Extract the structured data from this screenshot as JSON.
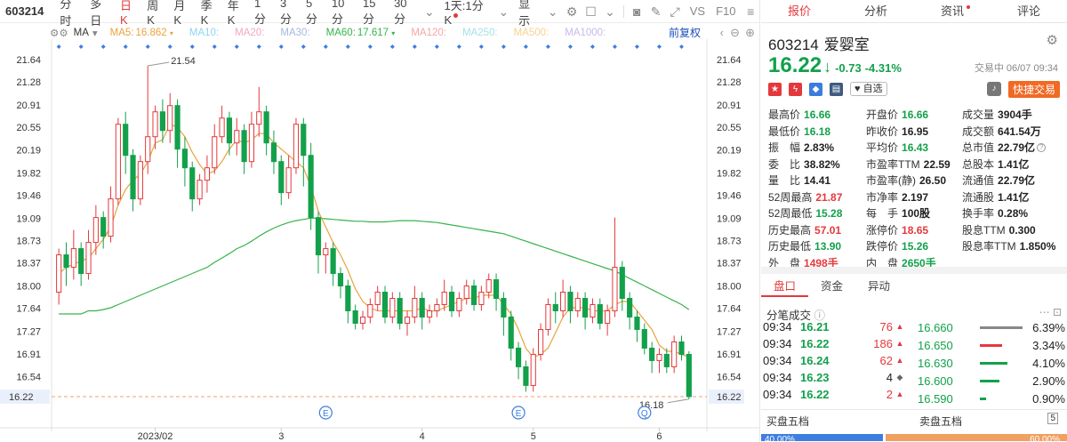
{
  "toolbar": {
    "code": "603214",
    "periods": [
      "分时",
      "多日",
      "日K",
      "周K",
      "月K",
      "季K",
      "年K",
      "1分",
      "3分",
      "5分",
      "10分",
      "15分",
      "30分"
    ],
    "active_period": "日K",
    "frame": "1天:1分K",
    "display": "显示",
    "vs": "VS",
    "f10": "F10"
  },
  "ma_bar": {
    "indicator": "MA",
    "items": [
      {
        "label": "MA5:",
        "value": "16.862",
        "color": "#e8a33d"
      },
      {
        "label": "MA10:",
        "value": "",
        "color": "#8fd3f4"
      },
      {
        "label": "MA20:",
        "value": "",
        "color": "#f4a6c8"
      },
      {
        "label": "MA30:",
        "value": "",
        "color": "#a6b8e0"
      },
      {
        "label": "MA60:",
        "value": "17.617",
        "color": "#36b34a"
      },
      {
        "label": "MA120:",
        "value": "",
        "color": "#f4a6a6"
      },
      {
        "label": "MA250:",
        "value": "",
        "color": "#a6e0e8"
      },
      {
        "label": "MA500:",
        "value": "",
        "color": "#f8d090"
      },
      {
        "label": "MA1000:",
        "value": "",
        "color": "#c8b8e8"
      }
    ],
    "fq": "前复权"
  },
  "chart_data": {
    "type": "candlestick",
    "y_ticks": [
      "21.64",
      "21.28",
      "20.91",
      "20.55",
      "20.19",
      "19.82",
      "19.46",
      "19.09",
      "18.73",
      "18.37",
      "18.00",
      "17.64",
      "17.27",
      "16.91",
      "16.54",
      "16.22"
    ],
    "ylim": [
      16.22,
      21.64
    ],
    "x_ticks": [
      "2023/02",
      "3",
      "4",
      "5",
      "6"
    ],
    "high_label": "21.54",
    "low_label": "16.18",
    "current_price": "16.22",
    "event_markers": [
      "E",
      "E",
      "Q"
    ],
    "series": [
      {
        "name": "K",
        "candles": [
          [
            17.9,
            18.5,
            17.7,
            18.6
          ],
          [
            18.5,
            18.3,
            18.0,
            18.7
          ],
          [
            18.3,
            18.6,
            18.1,
            18.9
          ],
          [
            18.6,
            18.2,
            18.0,
            18.7
          ],
          [
            18.2,
            18.7,
            18.1,
            18.9
          ],
          [
            18.7,
            19.1,
            18.5,
            19.3
          ],
          [
            19.1,
            18.8,
            18.6,
            19.2
          ],
          [
            18.8,
            19.4,
            18.7,
            19.6
          ],
          [
            19.4,
            20.6,
            19.3,
            20.7
          ],
          [
            20.6,
            20.1,
            19.8,
            20.8
          ],
          [
            20.1,
            19.4,
            19.2,
            20.2
          ],
          [
            19.4,
            20.0,
            19.3,
            20.1
          ],
          [
            20.0,
            20.4,
            19.8,
            21.54
          ],
          [
            20.4,
            20.8,
            20.2,
            20.9
          ],
          [
            20.8,
            20.5,
            20.3,
            21.0
          ],
          [
            20.5,
            20.9,
            20.3,
            21.1
          ],
          [
            20.9,
            20.2,
            19.9,
            21.0
          ],
          [
            20.2,
            19.9,
            19.6,
            20.4
          ],
          [
            19.9,
            19.4,
            19.2,
            20.0
          ],
          [
            19.4,
            19.7,
            19.3,
            19.8
          ],
          [
            19.7,
            19.9,
            19.5,
            20.1
          ],
          [
            19.9,
            20.4,
            19.8,
            20.6
          ],
          [
            20.4,
            20.7,
            20.3,
            20.9
          ],
          [
            20.7,
            20.3,
            20.1,
            20.8
          ],
          [
            20.3,
            20.5,
            20.1,
            20.7
          ],
          [
            20.5,
            20.0,
            19.8,
            20.6
          ],
          [
            20.0,
            20.6,
            19.9,
            20.8
          ],
          [
            20.6,
            20.8,
            20.4,
            21.2
          ],
          [
            20.8,
            20.3,
            20.1,
            20.9
          ],
          [
            20.3,
            20.0,
            19.8,
            20.5
          ],
          [
            20.0,
            19.5,
            19.3,
            20.1
          ],
          [
            19.5,
            19.9,
            19.4,
            20.1
          ],
          [
            19.9,
            20.6,
            19.8,
            20.7
          ],
          [
            20.6,
            20.1,
            19.6,
            20.7
          ],
          [
            20.1,
            19.1,
            18.9,
            20.3
          ],
          [
            19.1,
            18.5,
            18.2,
            19.2
          ],
          [
            18.5,
            18.6,
            18.2,
            18.7
          ],
          [
            18.6,
            18.2,
            18.0,
            18.7
          ],
          [
            18.2,
            18.0,
            17.8,
            18.3
          ],
          [
            18.0,
            17.6,
            17.4,
            18.1
          ],
          [
            17.6,
            17.4,
            17.3,
            17.7
          ],
          [
            17.4,
            17.5,
            17.3,
            17.6
          ],
          [
            17.5,
            17.7,
            17.4,
            17.8
          ],
          [
            17.7,
            17.9,
            17.6,
            18.0
          ],
          [
            17.9,
            17.5,
            17.4,
            18.0
          ],
          [
            17.5,
            17.8,
            17.4,
            17.9
          ],
          [
            17.8,
            17.4,
            17.3,
            17.9
          ],
          [
            17.4,
            17.5,
            17.2,
            17.6
          ],
          [
            17.5,
            17.8,
            17.4,
            18.0
          ],
          [
            17.8,
            17.5,
            17.3,
            17.9
          ],
          [
            17.5,
            17.6,
            17.4,
            17.7
          ],
          [
            17.6,
            17.7,
            17.5,
            17.8
          ],
          [
            17.7,
            17.9,
            17.6,
            18.1
          ],
          [
            17.9,
            17.6,
            17.5,
            18.0
          ],
          [
            17.6,
            17.8,
            17.5,
            17.9
          ],
          [
            17.8,
            18.0,
            17.7,
            18.1
          ],
          [
            18.0,
            17.7,
            17.6,
            18.1
          ],
          [
            17.7,
            17.9,
            17.6,
            18.0
          ],
          [
            17.9,
            18.1,
            17.8,
            18.2
          ],
          [
            18.1,
            17.8,
            17.6,
            18.2
          ],
          [
            17.8,
            17.5,
            17.2,
            17.9
          ],
          [
            17.5,
            17.0,
            16.8,
            17.6
          ],
          [
            17.0,
            16.7,
            16.5,
            17.1
          ],
          [
            16.7,
            16.4,
            16.3,
            16.8
          ],
          [
            16.4,
            16.9,
            16.3,
            17.0
          ],
          [
            16.9,
            17.3,
            16.8,
            17.4
          ],
          [
            17.3,
            17.7,
            17.2,
            17.8
          ],
          [
            17.7,
            17.6,
            17.4,
            17.9
          ],
          [
            17.6,
            17.9,
            17.5,
            18.1
          ],
          [
            17.9,
            17.6,
            17.4,
            18.0
          ],
          [
            17.6,
            17.8,
            17.5,
            17.9
          ],
          [
            17.8,
            17.5,
            17.3,
            17.9
          ],
          [
            17.5,
            17.7,
            17.4,
            17.8
          ],
          [
            17.7,
            17.4,
            17.3,
            17.8
          ],
          [
            17.4,
            17.6,
            17.2,
            17.7
          ],
          [
            17.6,
            18.3,
            17.5,
            19.1
          ],
          [
            18.3,
            17.8,
            17.6,
            18.4
          ],
          [
            17.8,
            17.5,
            17.3,
            17.9
          ],
          [
            17.5,
            17.3,
            17.1,
            17.6
          ],
          [
            17.3,
            17.0,
            16.9,
            17.4
          ],
          [
            17.0,
            16.8,
            16.6,
            17.1
          ],
          [
            16.8,
            16.9,
            16.6,
            17.0
          ],
          [
            16.9,
            16.7,
            16.6,
            17.0
          ],
          [
            16.7,
            17.1,
            16.6,
            17.2
          ],
          [
            17.1,
            16.9,
            16.8,
            17.2
          ],
          [
            16.9,
            16.22,
            16.18,
            16.95
          ]
        ]
      },
      {
        "name": "MA5",
        "values": [
          18.2,
          18.3,
          18.35,
          18.4,
          18.45,
          18.6,
          18.75,
          18.95,
          19.3,
          19.55,
          19.7,
          19.8,
          20.0,
          20.3,
          20.35,
          20.6,
          20.55,
          20.4,
          20.15,
          19.95,
          19.8,
          19.85,
          20.0,
          20.2,
          20.35,
          20.3,
          20.35,
          20.45,
          20.45,
          20.3,
          20.2,
          20.1,
          20.0,
          19.9,
          19.6,
          19.2,
          18.95,
          18.7,
          18.5,
          18.25,
          17.95,
          17.75,
          17.65,
          17.6,
          17.6,
          17.6,
          17.6,
          17.6,
          17.6,
          17.65,
          17.6,
          17.6,
          17.65,
          17.7,
          17.75,
          17.8,
          17.8,
          17.85,
          17.85,
          17.85,
          17.7,
          17.55,
          17.3,
          17.0,
          16.85,
          16.9,
          17.0,
          17.25,
          17.5,
          17.65,
          17.65,
          17.65,
          17.6,
          17.6,
          17.6,
          17.7,
          17.75,
          17.75,
          17.6,
          17.45,
          17.3,
          17.05,
          16.95,
          16.95,
          16.9,
          16.86
        ]
      },
      {
        "name": "MA60",
        "values": [
          17.55,
          17.55,
          17.55,
          17.55,
          17.6,
          17.6,
          17.62,
          17.65,
          17.7,
          17.75,
          17.8,
          17.85,
          17.9,
          17.95,
          18.0,
          18.05,
          18.1,
          18.15,
          18.2,
          18.25,
          18.3,
          18.38,
          18.45,
          18.52,
          18.6,
          18.65,
          18.72,
          18.8,
          18.87,
          18.93,
          18.98,
          19.02,
          19.05,
          19.07,
          19.09,
          19.09,
          19.08,
          19.07,
          19.06,
          19.05,
          19.04,
          19.04,
          19.03,
          19.03,
          19.03,
          19.04,
          19.05,
          19.05,
          19.05,
          19.04,
          19.03,
          19.02,
          19.0,
          18.98,
          18.96,
          18.94,
          18.92,
          18.9,
          18.88,
          18.86,
          18.84,
          18.8,
          18.76,
          18.72,
          18.68,
          18.64,
          18.6,
          18.56,
          18.52,
          18.48,
          18.44,
          18.4,
          18.36,
          18.32,
          18.28,
          18.24,
          18.18,
          18.12,
          18.06,
          18.0,
          17.94,
          17.88,
          17.82,
          17.76,
          17.7,
          17.62
        ]
      }
    ]
  },
  "right_tabs": [
    "报价",
    "分析",
    "资讯",
    "评论"
  ],
  "stock": {
    "code": "603214",
    "name": "爱婴室",
    "price": "16.22",
    "change": "-0.73",
    "change_pct": "-4.31%",
    "trade_info": "交易中 06/07 09:34",
    "watch_label": "自选",
    "trade_button": "快捷交易"
  },
  "quote_rows": [
    [
      [
        "最高价",
        "16.66",
        "green"
      ],
      [
        "开盘价",
        "16.66",
        "green"
      ],
      [
        "成交量",
        "3904手",
        "dark"
      ]
    ],
    [
      [
        "最低价",
        "16.18",
        "green"
      ],
      [
        "昨收价",
        "16.95",
        "dark"
      ],
      [
        "成交额",
        "641.54万",
        "dark"
      ]
    ],
    [
      [
        "振　幅",
        "2.83%",
        "dark"
      ],
      [
        "平均价",
        "16.43",
        "green"
      ],
      [
        "总市值",
        "22.79亿",
        "dark"
      ]
    ],
    [
      [
        "委　比",
        "38.82%",
        "dark"
      ],
      [
        "市盈率TTM",
        "22.59",
        "dark"
      ],
      [
        "总股本",
        "1.41亿",
        "dark"
      ]
    ],
    [
      [
        "量　比",
        "14.41",
        "dark"
      ],
      [
        "市盈率(静)",
        "26.50",
        "dark"
      ],
      [
        "流通值",
        "22.79亿",
        "dark"
      ]
    ],
    [
      [
        "52周最高",
        "21.87",
        "red"
      ],
      [
        "市净率",
        "2.197",
        "dark"
      ],
      [
        "流通股",
        "1.41亿",
        "dark"
      ]
    ],
    [
      [
        "52周最低",
        "15.28",
        "green"
      ],
      [
        "每　手",
        "100股",
        "dark"
      ],
      [
        "换手率",
        "0.28%",
        "dark"
      ]
    ],
    [
      [
        "历史最高",
        "57.01",
        "red"
      ],
      [
        "涨停价",
        "18.65",
        "red"
      ],
      [
        "股息TTM",
        "0.300",
        "dark"
      ]
    ],
    [
      [
        "历史最低",
        "13.90",
        "green"
      ],
      [
        "跌停价",
        "15.26",
        "green"
      ],
      [
        "股息率TTM",
        "1.850%",
        "dark"
      ]
    ],
    [
      [
        "外　盘",
        "1498手",
        "red"
      ],
      [
        "内　盘",
        "2650手",
        "green"
      ],
      [
        "",
        ""
      ]
    ]
  ],
  "sub_tabs": [
    "盘口",
    "资金",
    "异动"
  ],
  "fenbi_title": "分笔成交",
  "trades": [
    [
      "09:34",
      "16.21",
      "76",
      "up"
    ],
    [
      "09:34",
      "16.22",
      "186",
      "up"
    ],
    [
      "09:34",
      "16.24",
      "62",
      "up"
    ],
    [
      "09:34",
      "16.23",
      "4",
      "flat"
    ],
    [
      "09:34",
      "16.22",
      "2",
      "up"
    ],
    [
      "09:34",
      "16.22",
      "5",
      "up"
    ]
  ],
  "levels": [
    [
      "16.660",
      "6.39%",
      "#888888"
    ],
    [
      "16.650",
      "3.34%",
      "#e4393c"
    ],
    [
      "16.630",
      "4.10%",
      "#12a14a"
    ],
    [
      "16.600",
      "2.90%",
      "#12a14a"
    ],
    [
      "16.590",
      "0.90%",
      "#12a14a"
    ]
  ],
  "bottom": {
    "buy_label": "买盘五档",
    "sell_label": "卖盘五档",
    "buy_pct": "40.00%",
    "sell_pct": "60.00%"
  }
}
